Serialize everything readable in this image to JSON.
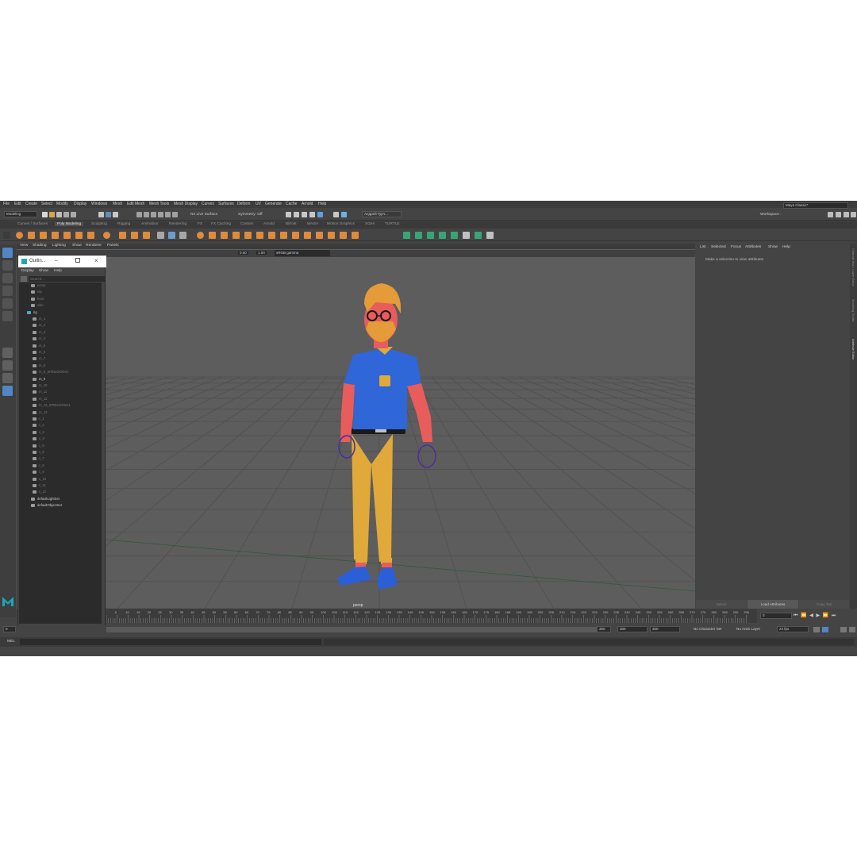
{
  "menubar": {
    "items": [
      "File",
      "Edit",
      "Create",
      "Select",
      "Modify",
      "Display",
      "Windows",
      "Mesh",
      "Edit Mesh",
      "Mesh Tools",
      "Mesh Display",
      "Curves",
      "Surfaces",
      "Deform",
      "UV",
      "Generate",
      "Cache",
      "Arnold",
      "Help"
    ],
    "workspace_label": "Workspace :",
    "workspace_value": "Maya Classic*"
  },
  "status": {
    "menu_set": "Modeling",
    "live_surface": "No Live Surface",
    "symmetry": "Symmetry: Off",
    "user": "Андрей Гурч..."
  },
  "shelf": {
    "tabs": [
      "Curves / Surfaces",
      "Poly Modeling",
      "Sculpting",
      "Rigging",
      "Animation",
      "Rendering",
      "FX",
      "FX Caching",
      "Custom",
      "Arnold",
      "Bifrost",
      "MASH",
      "Motion Graphics",
      "XGen",
      "TURTLE"
    ],
    "active_tab": "Poly Modeling"
  },
  "panel": {
    "menus": [
      "View",
      "Shading",
      "Lighting",
      "Show",
      "Renderer",
      "Panels"
    ],
    "exposure": "0.00",
    "gamma": "1.00",
    "color_space": "sRGB gamma",
    "camera_label": "persp"
  },
  "outliner": {
    "title": "Outlin...",
    "menus": [
      "Display",
      "Show",
      "Help"
    ],
    "search_placeholder": "Search...",
    "items": [
      {
        "label": "persp",
        "dim": true
      },
      {
        "label": "top",
        "dim": true
      },
      {
        "label": "front",
        "dim": true
      },
      {
        "label": "side",
        "dim": true
      },
      {
        "label": "rig",
        "dim": false
      },
      {
        "label": "m_1",
        "dim": true
      },
      {
        "label": "m_2",
        "dim": true
      },
      {
        "label": "m_3",
        "dim": true
      },
      {
        "label": "m_4",
        "dim": true
      },
      {
        "label": "m_5",
        "dim": true
      },
      {
        "label": "m_6",
        "dim": true
      },
      {
        "label": "m_7",
        "dim": true
      },
      {
        "label": "m_8",
        "dim": true
      },
      {
        "label": "m_9_SPBlockOlen1",
        "dim": true
      },
      {
        "label": "m_9",
        "dim": false
      },
      {
        "label": "m_10",
        "dim": true
      },
      {
        "label": "m_11",
        "dim": true
      },
      {
        "label": "m_12",
        "dim": true
      },
      {
        "label": "m_13_SPBlockOlen1",
        "dim": true
      },
      {
        "label": "m_13",
        "dim": true
      },
      {
        "label": "c_1",
        "dim": true
      },
      {
        "label": "c_2",
        "dim": true
      },
      {
        "label": "c_3",
        "dim": true
      },
      {
        "label": "c_4",
        "dim": true
      },
      {
        "label": "c_5",
        "dim": true
      },
      {
        "label": "c_6",
        "dim": true
      },
      {
        "label": "c_7",
        "dim": true
      },
      {
        "label": "c_8",
        "dim": true
      },
      {
        "label": "c_9",
        "dim": true
      },
      {
        "label": "c_10",
        "dim": true
      },
      {
        "label": "c_11",
        "dim": true
      },
      {
        "label": "c_12",
        "dim": true
      },
      {
        "label": "defaultLightSet",
        "dim": false
      },
      {
        "label": "defaultObjectSet",
        "dim": false
      }
    ]
  },
  "attribute_editor": {
    "menus": [
      "List",
      "Selected",
      "Focus",
      "Attributes",
      "Show",
      "Help"
    ],
    "message": "Make a selection to view attributes",
    "buttons": [
      "Select",
      "Load Attributes",
      "Copy Tab"
    ],
    "side_tabs": [
      "Channel Box / Layer Editor",
      "Modeling Toolkit",
      "Attribute Editor"
    ]
  },
  "timeline": {
    "tick_labels": [
      "5",
      "10",
      "15",
      "20",
      "25",
      "30",
      "35",
      "40",
      "45",
      "50",
      "55",
      "60",
      "65",
      "70",
      "75",
      "80",
      "85",
      "90",
      "95",
      "100",
      "105",
      "110",
      "115",
      "120",
      "125",
      "130",
      "135",
      "140",
      "145",
      "150",
      "155",
      "160",
      "165",
      "170",
      "175",
      "180",
      "185",
      "190",
      "195",
      "200",
      "205",
      "210",
      "215",
      "220",
      "225",
      "230",
      "235",
      "240",
      "245",
      "250",
      "255",
      "260",
      "265",
      "270",
      "275",
      "280",
      "285",
      "290",
      "295"
    ],
    "current_frame": "0",
    "range_start": "0",
    "range_start_inner": "300",
    "range_end_inner": "300",
    "range_end": "300",
    "character_set": "No Character Set",
    "anim_layer": "No Anim Layer",
    "fps": "24 fps"
  },
  "command_line": {
    "language": "MEL"
  },
  "colors": {
    "shirt": "#2f66d8",
    "skin": "#e85c5c",
    "pants": "#e0a93a",
    "shoes": "#2a5fd8",
    "hair": "#e59b38",
    "accent": "#3b8ed6"
  }
}
